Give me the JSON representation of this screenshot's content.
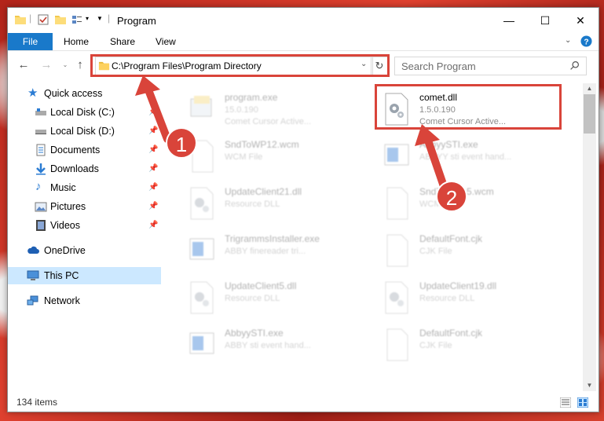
{
  "window": {
    "title": "Program"
  },
  "ribbon": {
    "file": "File",
    "home": "Home",
    "share": "Share",
    "view": "View"
  },
  "address": {
    "path": "C:\\Program Files\\Program Directory"
  },
  "search": {
    "placeholder": "Search Program"
  },
  "sidebar": {
    "items": [
      {
        "label": "Quick access"
      },
      {
        "label": "Local Disk (C:)"
      },
      {
        "label": "Local Disk (D:)"
      },
      {
        "label": "Documents"
      },
      {
        "label": "Downloads"
      },
      {
        "label": "Music"
      },
      {
        "label": "Pictures"
      },
      {
        "label": "Videos"
      },
      {
        "label": "OneDrive"
      },
      {
        "label": "This PC"
      },
      {
        "label": "Network"
      }
    ]
  },
  "files": [
    {
      "name": "program.exe",
      "line2": "15.0.190",
      "line3": "Comet Cursor Active..."
    },
    {
      "name": "comet.dll",
      "line2": "1.5.0.190",
      "line3": "Comet Cursor Active..."
    },
    {
      "name": "SndToWP12.wcm",
      "line2": "WCM File",
      "line3": ""
    },
    {
      "name": "AbbyySTI.exe",
      "line2": "ABBYY sti event hand...",
      "line3": ""
    },
    {
      "name": "UpdateClient21.dll",
      "line2": "Resource DLL",
      "line3": ""
    },
    {
      "name": "SndToWP15.wcm",
      "line2": "WCM File",
      "line3": ""
    },
    {
      "name": "TrigrammsInstaller.exe",
      "line2": "ABBY finereader tri...",
      "line3": ""
    },
    {
      "name": "DefaultFont.cjk",
      "line2": "CJK File",
      "line3": ""
    },
    {
      "name": "UpdateClient5.dll",
      "line2": "Resource DLL",
      "line3": ""
    },
    {
      "name": "UpdateClient19.dll",
      "line2": "Resource DLL",
      "line3": ""
    },
    {
      "name": "AbbyySTI.exe",
      "line2": "ABBY sti event hand...",
      "line3": ""
    },
    {
      "name": "DefaultFont.cjk",
      "line2": "CJK File",
      "line3": ""
    }
  ],
  "status": {
    "count": "134 items"
  },
  "callouts": {
    "one": "1",
    "two": "2"
  },
  "colors": {
    "accent": "#1979ca",
    "highlight": "#d9443a",
    "selected": "#cce8ff"
  }
}
